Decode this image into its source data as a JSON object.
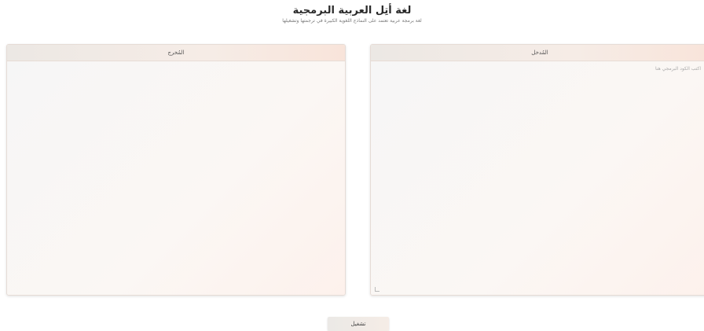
{
  "header": {
    "title": "لغة أتِل العربية البرمجية",
    "subtitle": "لغة برمجة عربية تعتمد على النماذج اللغوية الكبيرة في ترجمتها وتشغيلها"
  },
  "output_panel": {
    "label": "المُخرج"
  },
  "input_panel": {
    "label": "المُدخل",
    "placeholder": "اكتب الكود البرمجي هنا",
    "value": ""
  },
  "run_button": {
    "label": "تشغيل"
  },
  "colors": {
    "panel_header_start": "#ece8e4",
    "panel_header_end": "#f8e4da",
    "panel_border": "#e6dcd6"
  }
}
